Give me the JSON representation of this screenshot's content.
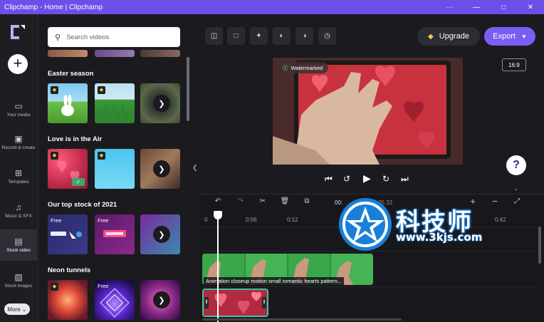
{
  "window": {
    "title": "Clipchamp - Home | Clipchamp",
    "controls": [
      "···",
      "—",
      "□",
      "✕"
    ]
  },
  "rail": {
    "items": [
      {
        "label": "Your media",
        "icon": "folder-icon",
        "glyph": "▭"
      },
      {
        "label": "Record & create",
        "icon": "camera-icon",
        "glyph": "▣"
      },
      {
        "label": "Templates",
        "icon": "templates-icon",
        "glyph": "⊞"
      },
      {
        "label": "Music & SFX",
        "icon": "music-icon",
        "glyph": "♫"
      },
      {
        "label": "Stock video",
        "icon": "film-icon",
        "glyph": "▤",
        "active": true
      },
      {
        "label": "Stock images",
        "icon": "image-icon",
        "glyph": "▧"
      }
    ],
    "more_label": "More ⌄"
  },
  "panel": {
    "search_placeholder": "Search videos",
    "sections": [
      {
        "title": "Easter season"
      },
      {
        "title": "Love is in the Air"
      },
      {
        "title": "Our top stock of 2021"
      },
      {
        "title": "Neon tunnels"
      }
    ],
    "free_label": "Free"
  },
  "toolbar": {
    "upgrade_label": "Upgrade",
    "export_label": "Export"
  },
  "preview": {
    "aspect_ratio": "16:9",
    "watermark_tag": "Watermarked"
  },
  "timeline": {
    "timecode_left": "00:",
    "timecode_right": "25.32",
    "ruler": [
      "0",
      "0:06",
      "0:12",
      "0:42"
    ],
    "clip_title": "Animation closeup motion small romantic hearts pattern..."
  },
  "overlay": {
    "brand_text": "科技师",
    "brand_url": "www.3kjs.com"
  },
  "colors": {
    "accent": "#7b5df2",
    "titlebar": "#6c4fe8",
    "background": "#1b1b1f",
    "selected_outline": "#3fbfa5"
  }
}
